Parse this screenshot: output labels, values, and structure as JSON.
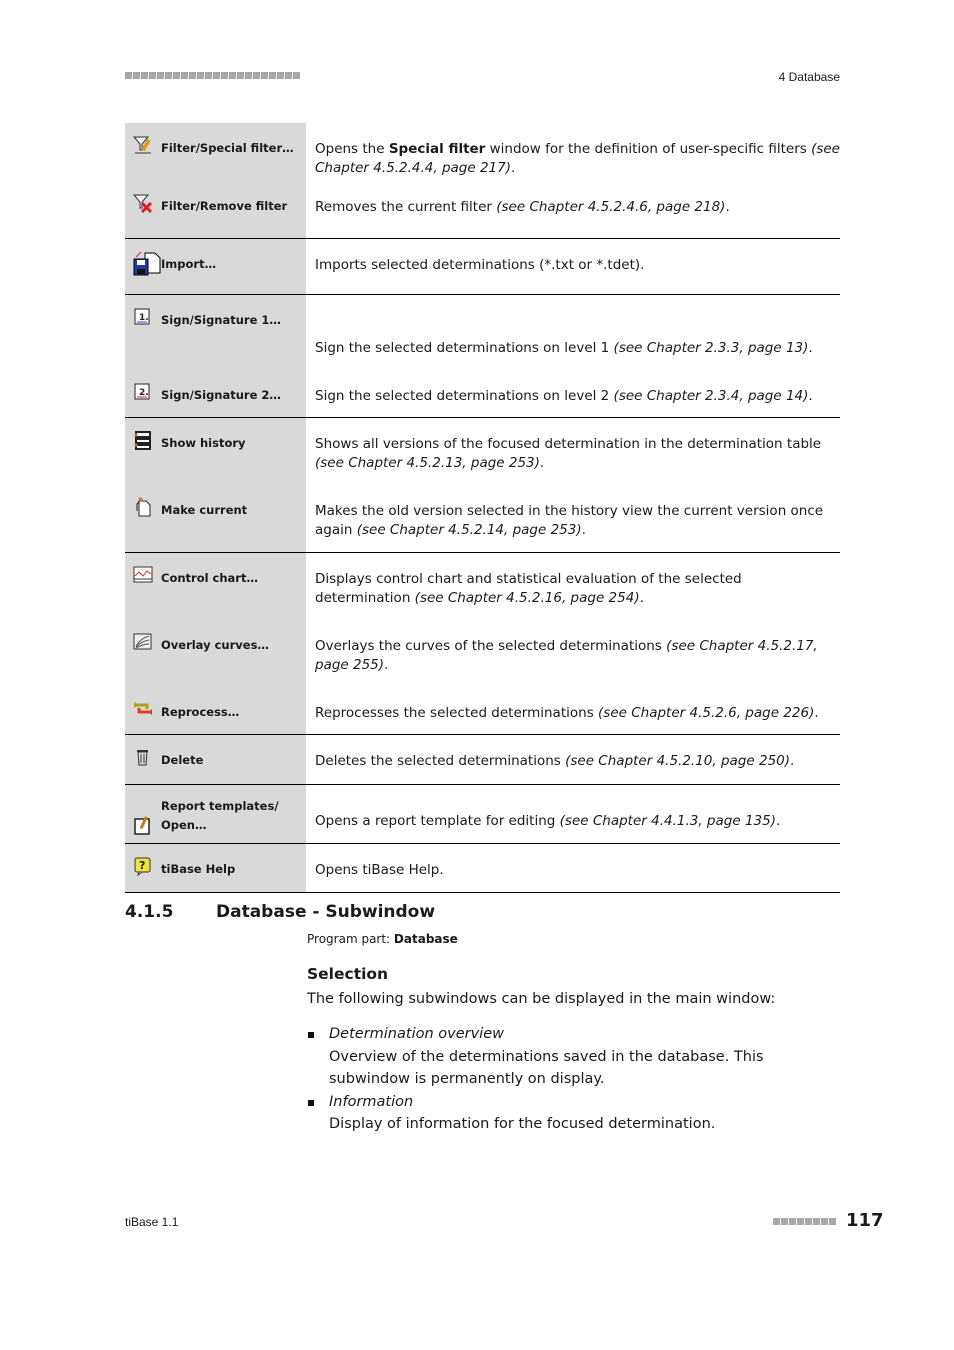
{
  "header": {
    "chapter": "4 Database",
    "dots_count": 22
  },
  "commands": [
    {
      "group": [
        {
          "icon": "filter-special-icon",
          "label": "Filter/Special filter…",
          "desc": [
            {
              "t": "Opens the "
            },
            {
              "t": "Special filter",
              "b": true
            },
            {
              "t": " window for the definition of user-specific filters "
            },
            {
              "t": "(see Chapter 4.5.2.4.4, page 217)",
              "i": true
            },
            {
              "t": "."
            }
          ]
        },
        {
          "icon": "filter-remove-icon",
          "label": "Filter/Remove filter",
          "desc": [
            {
              "t": "Removes the current filter "
            },
            {
              "t": "(see Chapter 4.5.2.4.6, page 218)",
              "i": true
            },
            {
              "t": "."
            }
          ]
        }
      ]
    },
    {
      "group": [
        {
          "icon": "import-icon",
          "label": "Import…",
          "desc": [
            {
              "t": "Imports selected determinations (*.txt or *.tdet)."
            }
          ]
        }
      ]
    },
    {
      "group": [
        {
          "icon": "signature-1-icon",
          "label": "Sign/Signature 1…",
          "desc": [
            {
              "t": "Sign the selected determinations on level 1 "
            },
            {
              "t": "(see Chapter 2.3.3, page 13)",
              "i": true
            },
            {
              "t": "."
            }
          ]
        },
        {
          "icon": "signature-2-icon",
          "label": "Sign/Signature 2…",
          "desc": [
            {
              "t": "Sign the selected determinations on level 2 "
            },
            {
              "t": "(see Chapter 2.3.4, page 14)",
              "i": true
            },
            {
              "t": "."
            }
          ]
        }
      ]
    },
    {
      "group": [
        {
          "icon": "show-history-icon",
          "label": "Show history",
          "desc": [
            {
              "t": "Shows all versions of the focused determination in the determination table "
            },
            {
              "t": "(see Chapter 4.5.2.13, page 253)",
              "i": true
            },
            {
              "t": "."
            }
          ]
        },
        {
          "icon": "make-current-icon",
          "label": "Make current",
          "desc": [
            {
              "t": "Makes the old version selected in the history view the current version once again "
            },
            {
              "t": "(see Chapter 4.5.2.14, page 253)",
              "i": true
            },
            {
              "t": "."
            }
          ]
        }
      ]
    },
    {
      "group": [
        {
          "icon": "control-chart-icon",
          "label": "Control chart…",
          "desc": [
            {
              "t": "Displays control chart and statistical evaluation of the selected determination "
            },
            {
              "t": "(see Chapter 4.5.2.16, page 254)",
              "i": true
            },
            {
              "t": "."
            }
          ]
        },
        {
          "icon": "overlay-curves-icon",
          "label": "Overlay curves…",
          "desc": [
            {
              "t": "Overlays the curves of the selected determinations "
            },
            {
              "t": "(see Chapter 4.5.2.17, page 255)",
              "i": true
            },
            {
              "t": "."
            }
          ]
        },
        {
          "icon": "reprocess-icon",
          "label": "Reprocess…",
          "desc": [
            {
              "t": "Reprocesses the selected determinations "
            },
            {
              "t": "(see Chapter 4.5.2.6, page 226)",
              "i": true
            },
            {
              "t": "."
            }
          ]
        }
      ]
    },
    {
      "group": [
        {
          "icon": "delete-icon",
          "label": "Delete",
          "desc": [
            {
              "t": "Deletes the selected determinations "
            },
            {
              "t": "(see Chapter 4.5.2.10, page 250)",
              "i": true
            },
            {
              "t": "."
            }
          ]
        }
      ]
    },
    {
      "group": [
        {
          "icon": "report-template-icon",
          "label": "Report templates/ Open…",
          "desc": [
            {
              "t": "Opens a report template for editing "
            },
            {
              "t": "(see Chapter 4.4.1.3, page 135)",
              "i": true
            },
            {
              "t": "."
            }
          ]
        }
      ]
    },
    {
      "group": [
        {
          "icon": "help-icon",
          "label": "tiBase Help",
          "desc": [
            {
              "t": "Opens tiBase Help."
            }
          ]
        }
      ]
    }
  ],
  "section": {
    "number": "4.1.5",
    "title": "Database - Subwindow",
    "program_part_label": "Program part: ",
    "program_part_value": "Database",
    "subheading": "Selection",
    "intro": "The following subwindows can be displayed in the main window:",
    "items": [
      {
        "title": "Determination overview",
        "text": "Overview of the determinations saved in the database. This subwindow is permanently on display."
      },
      {
        "title": "Information",
        "text": "Display of information for the focused determination."
      }
    ]
  },
  "footer": {
    "product": "tiBase 1.1",
    "page": "117",
    "dots_count": 8
  }
}
